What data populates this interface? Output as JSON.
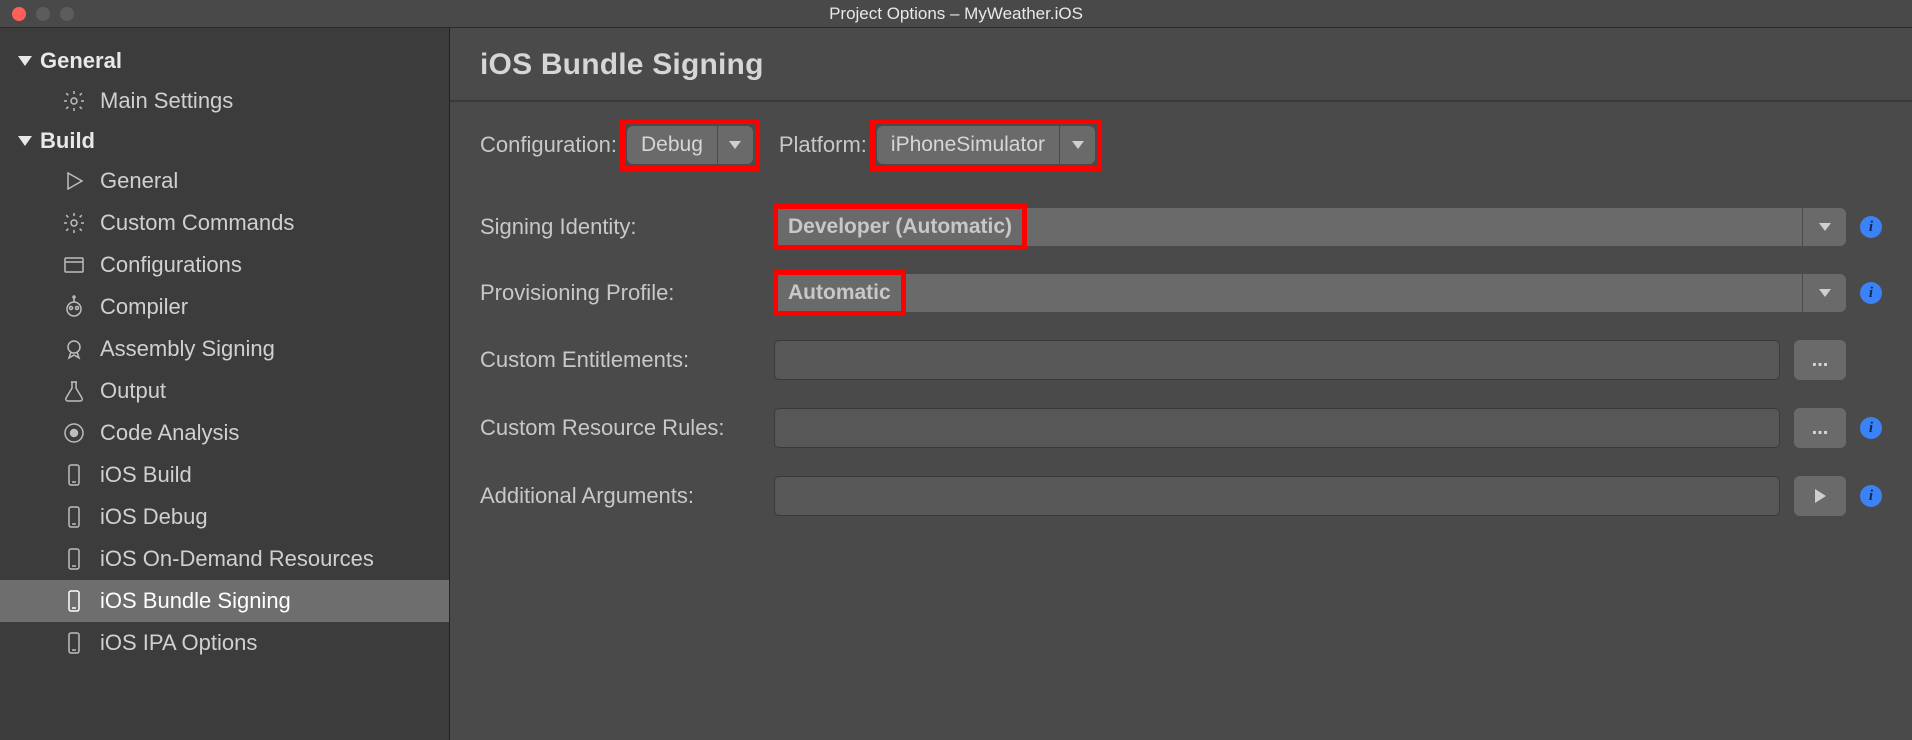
{
  "window": {
    "title": "Project Options – MyWeather.iOS"
  },
  "sidebar": {
    "sections": [
      {
        "label": "General",
        "items": [
          {
            "label": "Main Settings"
          }
        ]
      },
      {
        "label": "Build",
        "items": [
          {
            "label": "General"
          },
          {
            "label": "Custom Commands"
          },
          {
            "label": "Configurations"
          },
          {
            "label": "Compiler"
          },
          {
            "label": "Assembly Signing"
          },
          {
            "label": "Output"
          },
          {
            "label": "Code Analysis"
          },
          {
            "label": "iOS Build"
          },
          {
            "label": "iOS Debug"
          },
          {
            "label": "iOS On-Demand Resources"
          },
          {
            "label": "iOS Bundle Signing"
          },
          {
            "label": "iOS IPA Options"
          }
        ]
      }
    ]
  },
  "page": {
    "title": "iOS Bundle Signing",
    "configuration_label": "Configuration:",
    "configuration_value": "Debug",
    "platform_label": "Platform:",
    "platform_value": "iPhoneSimulator",
    "rows": {
      "signing_identity": {
        "label": "Signing Identity:",
        "value": "Developer (Automatic)"
      },
      "provisioning": {
        "label": "Provisioning Profile:",
        "value": "Automatic"
      },
      "entitlements": {
        "label": "Custom Entitlements:",
        "value": ""
      },
      "resource_rules": {
        "label": "Custom Resource Rules:",
        "value": ""
      },
      "additional_args": {
        "label": "Additional Arguments:",
        "value": ""
      }
    },
    "ellipsis": "...",
    "info_glyph": "i"
  }
}
